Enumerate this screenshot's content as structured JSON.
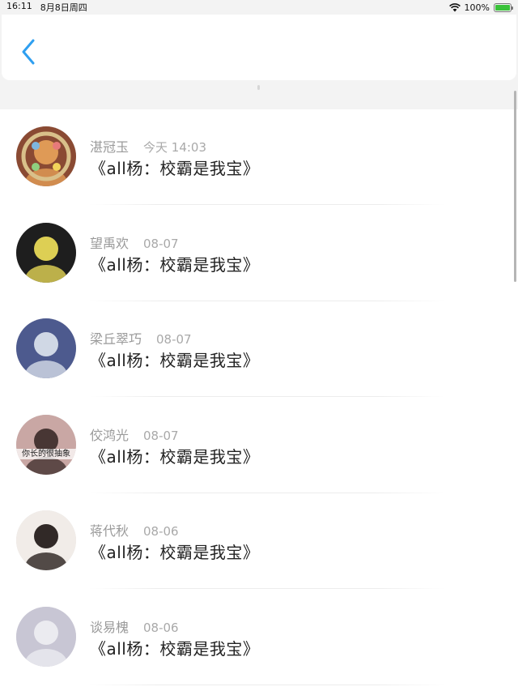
{
  "status_bar": {
    "time": "16:11",
    "date": "8月8日周四",
    "battery": "100%",
    "battery_level": 1.0
  },
  "nav": {
    "back_icon": "chevron-left-icon",
    "accent_color": "#2f9ff0"
  },
  "messages": [
    {
      "name": "湛冠玉",
      "time": "今天 14:03",
      "title": "《all杨：校霸是我宝》",
      "avatar_color": "#8a4a33",
      "avatar_accent": "#e8a35a"
    },
    {
      "name": "望禹欢",
      "time": "08-07",
      "title": "《all杨：校霸是我宝》",
      "avatar_color": "#1e1e1e",
      "avatar_accent": "#f2e25a"
    },
    {
      "name": "梁丘翠巧",
      "time": "08-07",
      "title": "《all杨：校霸是我宝》",
      "avatar_color": "#4d5a8e",
      "avatar_accent": "#dfe6ee"
    },
    {
      "name": "佼鸿光",
      "time": "08-07",
      "title": "《all杨：校霸是我宝》",
      "avatar_caption": "你长的很抽象",
      "avatar_color": "#c9a7a4",
      "avatar_accent": "#3a2a28"
    },
    {
      "name": "蒋代秋",
      "time": "08-06",
      "title": "《all杨：校霸是我宝》",
      "avatar_color": "#f1ece8",
      "avatar_accent": "#1c1412"
    },
    {
      "name": "谈易槐",
      "time": "08-06",
      "title": "《all杨：校霸是我宝》",
      "avatar_color": "#c8c6d4",
      "avatar_accent": "#eeeef3"
    }
  ]
}
